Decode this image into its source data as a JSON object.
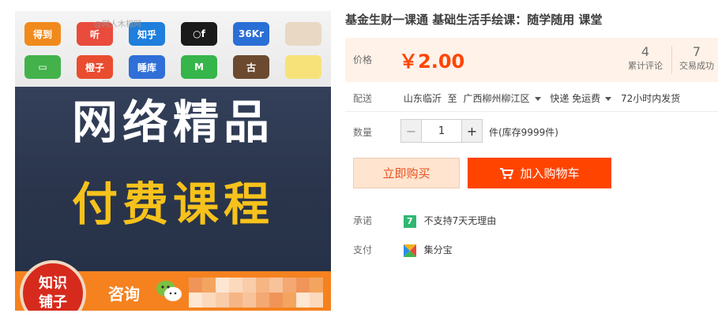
{
  "image": {
    "watermark": "@网人木相网",
    "apps": [
      {
        "label": "得到",
        "color": "#f08a1c"
      },
      {
        "label": "听",
        "color": "#e94b3c"
      },
      {
        "label": "知乎",
        "color": "#1e7fdc"
      },
      {
        "label": "○f",
        "color": "#1a1a1a"
      },
      {
        "label": "36Kr",
        "color": "#2a6fd6"
      },
      {
        "label": "",
        "color": "#e8d8c4"
      },
      {
        "label": "▭",
        "color": "#43b24a"
      },
      {
        "label": "橙子",
        "color": "#ea4c2f"
      },
      {
        "label": "睡库",
        "color": "#2f6fd7"
      },
      {
        "label": "M",
        "color": "#35b54a"
      },
      {
        "label": "古",
        "color": "#6b4a2f"
      },
      {
        "label": "",
        "color": "#f7e27a"
      }
    ],
    "headline_1": "网络精品",
    "headline_2": "付费课程",
    "badge": [
      "知识",
      "铺子"
    ],
    "consult": "咨询"
  },
  "product": {
    "title": "基金生财一课通 基础生活手绘课：随学随用 课堂",
    "price_label": "价格",
    "price": "￥2.00",
    "stats": [
      {
        "num": "4",
        "label": "累计评论"
      },
      {
        "num": "7",
        "label": "交易成功"
      }
    ],
    "shipping": {
      "label": "配送",
      "from": "山东临沂",
      "to_word": "至",
      "to": "广西柳州柳江区",
      "method": "快递 免运费",
      "dispatch": "72小时内发货"
    },
    "quantity": {
      "label": "数量",
      "minus": "−",
      "value": "1",
      "plus": "+",
      "stock": "件(库存9999件)"
    },
    "buy_now": "立即购买",
    "add_to_cart": "加入购物车",
    "promise": {
      "label": "承诺",
      "badge": "7",
      "text": "不支持7天无理由"
    },
    "payment": {
      "label": "支付",
      "text": "集分宝"
    }
  }
}
